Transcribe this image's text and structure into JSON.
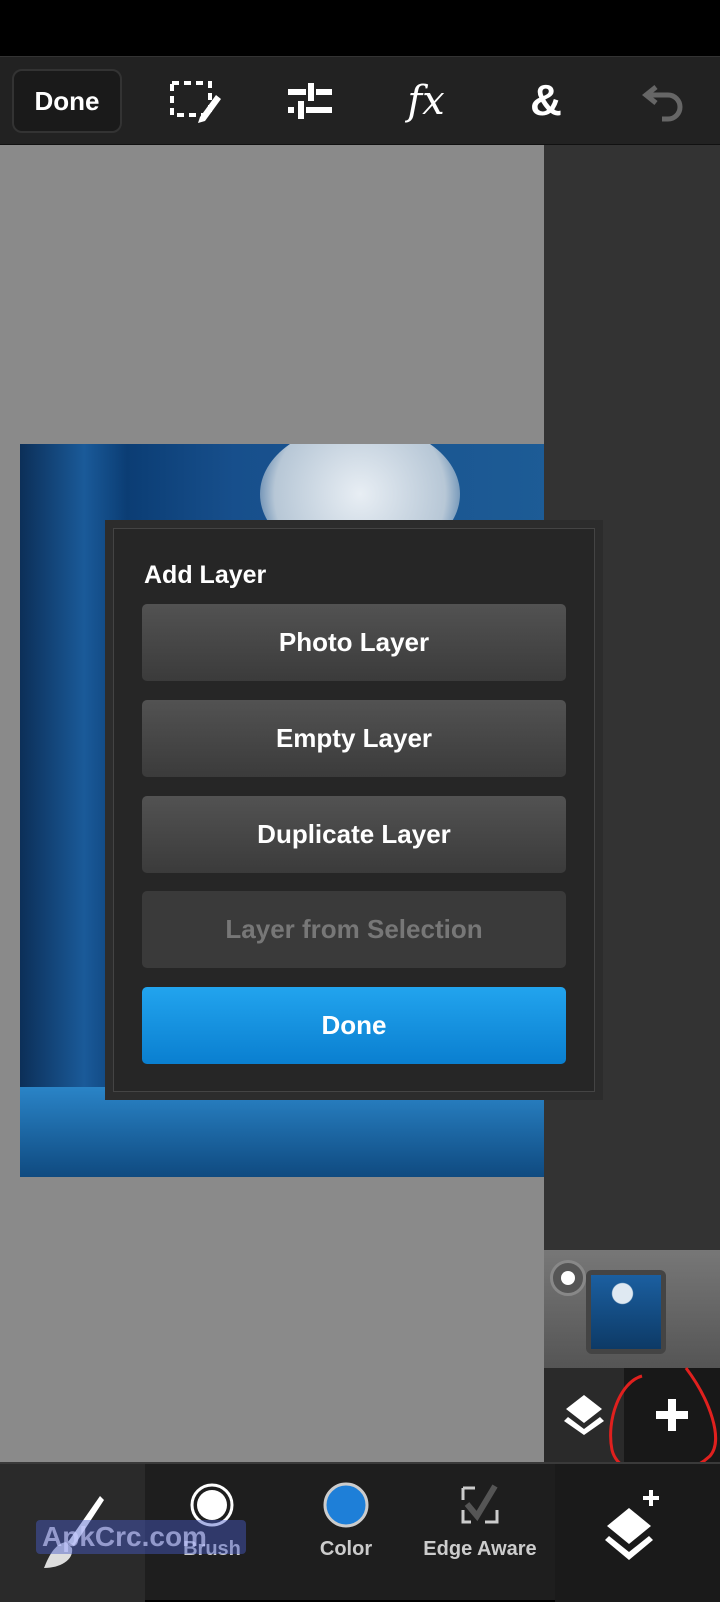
{
  "toolbar": {
    "done_label": "Done",
    "icons": [
      "selection-edit-icon",
      "adjustments-icon",
      "fx-icon",
      "ampersand-icon",
      "undo-icon"
    ],
    "fx_label": "fx",
    "amp_label": "&"
  },
  "dialog": {
    "title": "Add Layer",
    "buttons": [
      {
        "label": "Photo Layer",
        "enabled": true
      },
      {
        "label": "Empty Layer",
        "enabled": true
      },
      {
        "label": "Duplicate Layer",
        "enabled": true
      },
      {
        "label": "Layer from Selection",
        "enabled": false
      }
    ],
    "done_label": "Done"
  },
  "bottom": {
    "brush_label": "Brush",
    "color_label": "Color",
    "edge_label": "Edge Aware",
    "color_value": "#1e7fd8"
  },
  "watermark": "ApkCrc.com",
  "colors": {
    "accent": "#12a0ea",
    "annotation": "#e0201e"
  }
}
